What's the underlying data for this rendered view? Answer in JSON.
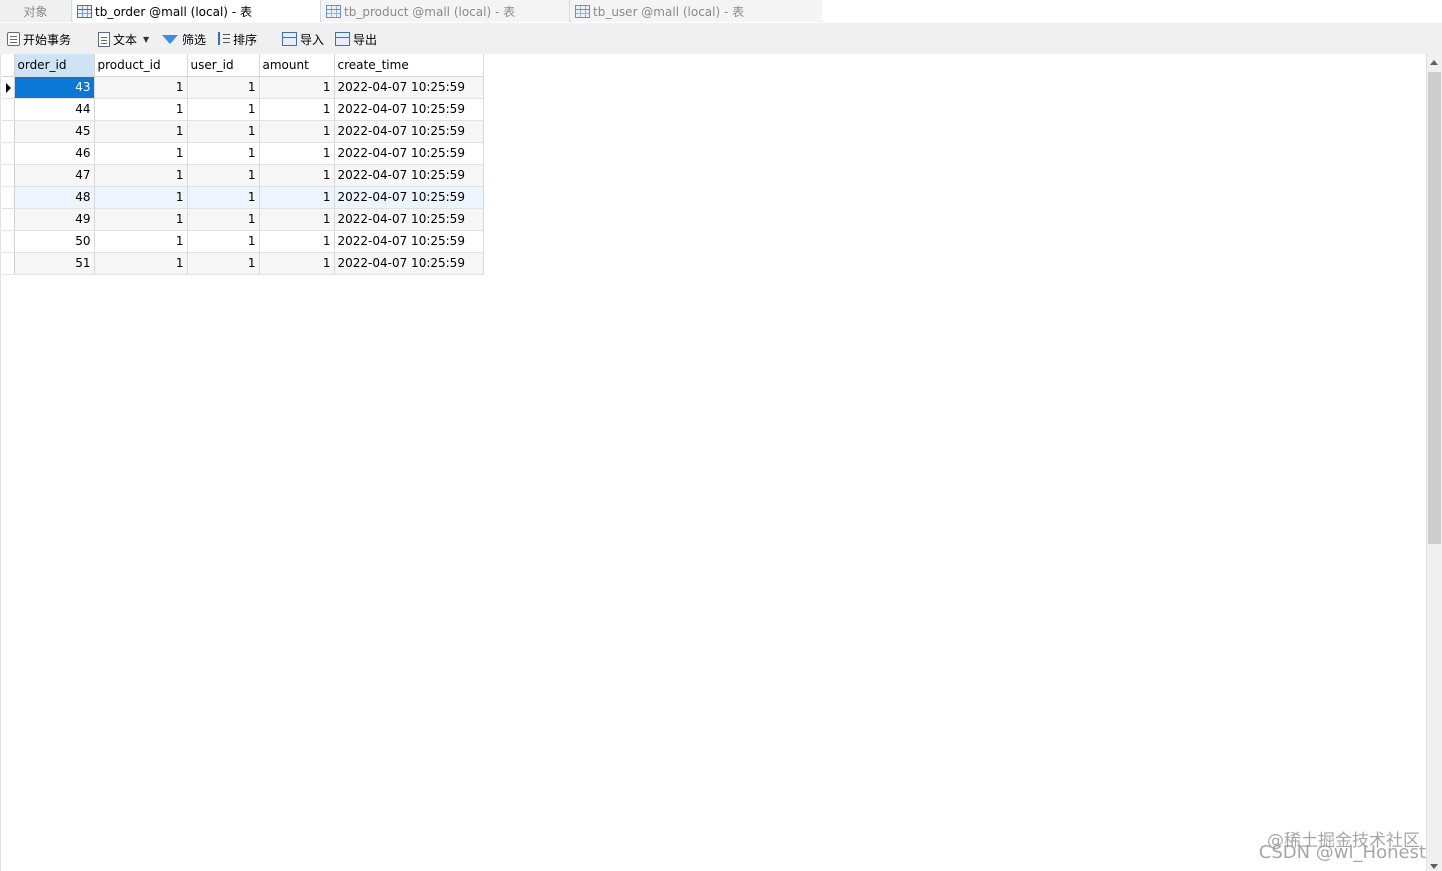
{
  "tabs": {
    "objects": "对象",
    "items": [
      {
        "label": "tb_order @mall (local) - 表",
        "icon": "table-icon",
        "active": true
      },
      {
        "label": "tb_product @mall (local) - 表",
        "icon": "table-icon",
        "active": false
      },
      {
        "label": "tb_user @mall (local) - 表",
        "icon": "table-icon",
        "active": false
      }
    ]
  },
  "toolbar": {
    "begin_transaction": "开始事务",
    "text": "文本",
    "filter": "筛选",
    "sort": "排序",
    "import": "导入",
    "export": "导出"
  },
  "grid": {
    "columns": [
      "order_id",
      "product_id",
      "user_id",
      "amount",
      "create_time"
    ],
    "rows": [
      [
        "43",
        "1",
        "1",
        "1",
        "2022-04-07 10:25:59"
      ],
      [
        "44",
        "1",
        "1",
        "1",
        "2022-04-07 10:25:59"
      ],
      [
        "45",
        "1",
        "1",
        "1",
        "2022-04-07 10:25:59"
      ],
      [
        "46",
        "1",
        "1",
        "1",
        "2022-04-07 10:25:59"
      ],
      [
        "47",
        "1",
        "1",
        "1",
        "2022-04-07 10:25:59"
      ],
      [
        "48",
        "1",
        "1",
        "1",
        "2022-04-07 10:25:59"
      ],
      [
        "49",
        "1",
        "1",
        "1",
        "2022-04-07 10:25:59"
      ],
      [
        "50",
        "1",
        "1",
        "1",
        "2022-04-07 10:25:59"
      ],
      [
        "51",
        "1",
        "1",
        "1",
        "2022-04-07 10:25:59"
      ]
    ]
  },
  "colors": {
    "selected_cell": "#0b78d7",
    "header_selected": "#cfe3f7"
  },
  "watermark": {
    "line1": "@稀土掘金技术社区",
    "line2": "CSDN @wl_Honest"
  }
}
